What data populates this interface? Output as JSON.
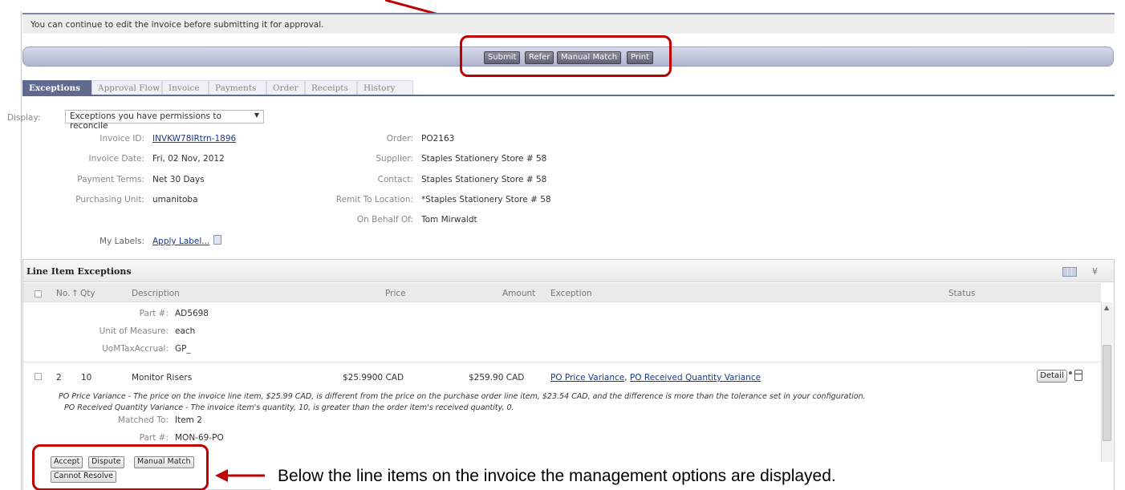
{
  "notice": "You can continue to edit the invoice before submitting it for approval.",
  "actions": [
    "Submit",
    "Refer",
    "Manual Match",
    "Print"
  ],
  "tabs": [
    "Exceptions",
    "Approval Flow",
    "Invoice",
    "Payments",
    "Order",
    "Receipts",
    "History"
  ],
  "active_tab": "Exceptions",
  "display": {
    "label": "Display:",
    "value": "Exceptions you have permissions to reconcile",
    "caret": "▼"
  },
  "header_left": [
    {
      "label": "Invoice ID:",
      "value": "INVKW78IRtrn-1896"
    },
    {
      "label": "Invoice Date:",
      "value": "Fri, 02 Nov, 2012"
    },
    {
      "label": "Payment Terms:",
      "value": "Net 30 Days"
    },
    {
      "label": "Purchasing Unit:",
      "value": "umanitoba"
    }
  ],
  "header_right": [
    {
      "label": "Order:",
      "value": "PO2163"
    },
    {
      "label": "Supplier:",
      "value": "Staples Stationery Store # 58"
    },
    {
      "label": "Contact:",
      "value": "Staples Stationery Store # 58"
    },
    {
      "label": "Remit To Location:",
      "value": "*Staples Stationery Store # 58"
    },
    {
      "label": "On Behalf Of:",
      "value": "Tom Mirwaldt"
    }
  ],
  "labels": {
    "label": "My Labels:",
    "link": "Apply Label..."
  },
  "panel_title": "Line Item Exceptions",
  "columns": {
    "no": "No.",
    "sort": "↑",
    "qty": "Qty",
    "description": "Description",
    "price": "Price",
    "amount": "Amount",
    "exception": "Exception",
    "status": "Status"
  },
  "prev_item": [
    {
      "label": "Part #:",
      "value": "AD5698"
    },
    {
      "label": "Unit of Measure:",
      "value": "each"
    },
    {
      "label": "UoMTaxAccrual:",
      "value": "GP_"
    }
  ],
  "line_item": {
    "no": "2",
    "qty": "10",
    "description": "Monitor Risers",
    "price": "$25.9900 CAD",
    "amount": "$259.90 CAD",
    "exception1": "PO Price Variance",
    "exception_sep": ",",
    "exception2": "PO Received Quantity Variance",
    "detail": "Detail",
    "note1": "PO Price Variance - The price on the invoice line item, $25.99 CAD, is different from the price on the purchase order line item, $23.54 CAD, and the difference is more than the tolerance set in your configuration.",
    "note2": "PO Received Quantity Variance - The invoice item's quantity, 10, is greater than the order item's received quantity, 0.",
    "matched_label": "Matched To:",
    "matched_value": "Item 2",
    "part_label": "Part #:",
    "part_value": "MON-69-PO"
  },
  "management": [
    "Accept",
    "Dispute",
    "Manual Match",
    "Cannot Resolve"
  ],
  "callout": "Below the line items on the invoice the management options are displayed.",
  "colors": {
    "annotation": "#c00000",
    "tab_active": "#5f6a8e",
    "link": "#1a3a8a"
  }
}
